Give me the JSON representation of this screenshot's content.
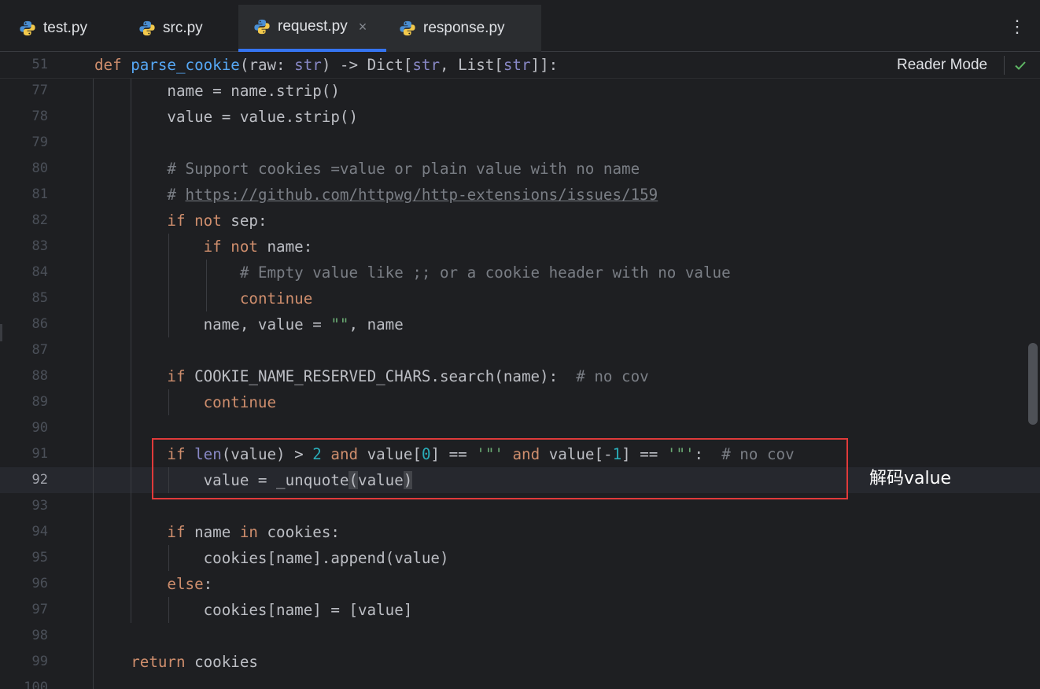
{
  "tabs": [
    {
      "label": "test.py",
      "icon": "python-icon"
    },
    {
      "label": "src.py",
      "icon": "python-icon"
    },
    {
      "label": "request.py",
      "icon": "python-icon",
      "active": true,
      "close": "×"
    },
    {
      "label": "response.py",
      "icon": "python-icon"
    }
  ],
  "more_menu": "⋮",
  "reader_mode": {
    "label": "Reader Mode",
    "icon": "checkmark-icon"
  },
  "sticky_line": {
    "num": "51",
    "text": "def parse_cookie(raw: str) -> Dict[str, List[str]]:"
  },
  "lines": [
    {
      "num": "77",
      "text": "        name = name.strip()"
    },
    {
      "num": "78",
      "text": "        value = value.strip()"
    },
    {
      "num": "79",
      "text": ""
    },
    {
      "num": "80",
      "text": "        # Support cookies =value or plain value with no name"
    },
    {
      "num": "81",
      "text": "        # https://github.com/httpwg/http-extensions/issues/159"
    },
    {
      "num": "82",
      "text": "        if not sep:"
    },
    {
      "num": "83",
      "text": "            if not name:"
    },
    {
      "num": "84",
      "text": "                # Empty value like ;; or a cookie header with no value"
    },
    {
      "num": "85",
      "text": "                continue"
    },
    {
      "num": "86",
      "text": "            name, value = \"\", name"
    },
    {
      "num": "87",
      "text": ""
    },
    {
      "num": "88",
      "text": "        if COOKIE_NAME_RESERVED_CHARS.search(name):  # no cov"
    },
    {
      "num": "89",
      "text": "            continue"
    },
    {
      "num": "90",
      "text": ""
    },
    {
      "num": "91",
      "text": "        if len(value) > 2 and value[0] == '\"' and value[-1] == '\"':  # no cov"
    },
    {
      "num": "92",
      "text": "            value = _unquote(value)"
    },
    {
      "num": "93",
      "text": ""
    },
    {
      "num": "94",
      "text": "        if name in cookies:"
    },
    {
      "num": "95",
      "text": "            cookies[name].append(value)"
    },
    {
      "num": "96",
      "text": "        else:"
    },
    {
      "num": "97",
      "text": "            cookies[name] = [value]"
    },
    {
      "num": "98",
      "text": ""
    },
    {
      "num": "99",
      "text": "    return cookies"
    },
    {
      "num": "100",
      "text": ""
    }
  ],
  "current_line": "92",
  "annotation": {
    "text": "解码value"
  },
  "colors": {
    "background": "#1e1f22",
    "keyword": "#cf8e6d",
    "function": "#56a8f5",
    "builtin": "#8888c6",
    "number": "#2aacb8",
    "string": "#6aab73",
    "comment": "#7a7e85",
    "accent": "#3574f0",
    "annotation_box": "#e03a3a"
  }
}
